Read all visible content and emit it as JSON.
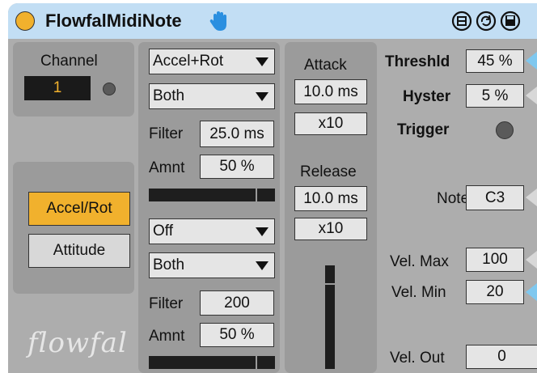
{
  "device": {
    "title": "FlowfalMidiNote",
    "power_color": "#f1b12d",
    "titlebar_color": "#c2def4",
    "accent_color": "#f1b12d",
    "logo": "flowfal"
  },
  "channel": {
    "label": "Channel",
    "value": "1"
  },
  "mode_buttons": {
    "accel_rot": "Accel/Rot",
    "attitude": "Attitude",
    "selected": "Accel/Rot"
  },
  "group1": {
    "source_select": "Accel+Rot",
    "direction_select": "Both",
    "filter_label": "Filter",
    "filter_value": "25.0 ms",
    "amnt_label": "Amnt",
    "amnt_value": "50 %"
  },
  "group2": {
    "source_select": "Off",
    "direction_select": "Both",
    "filter_label": "Filter",
    "filter_value": "200",
    "amnt_label": "Amnt",
    "amnt_value": "50 %"
  },
  "envelope": {
    "attack_label": "Attack",
    "attack_value": "10.0 ms",
    "attack_mult": "x10",
    "release_label": "Release",
    "release_value": "10.0 ms",
    "release_mult": "x10"
  },
  "right": {
    "threshold_label": "Threshld",
    "threshold_value": "45 %",
    "hyster_label": "Hyster",
    "hyster_value": "5 %",
    "trigger_label": "Trigger",
    "note_label": "Note",
    "note_value": "C3",
    "velmax_label": "Vel. Max",
    "velmax_value": "100",
    "velmin_label": "Vel. Min",
    "velmin_value": "20",
    "velout_label": "Vel. Out",
    "velout_value": "0"
  }
}
